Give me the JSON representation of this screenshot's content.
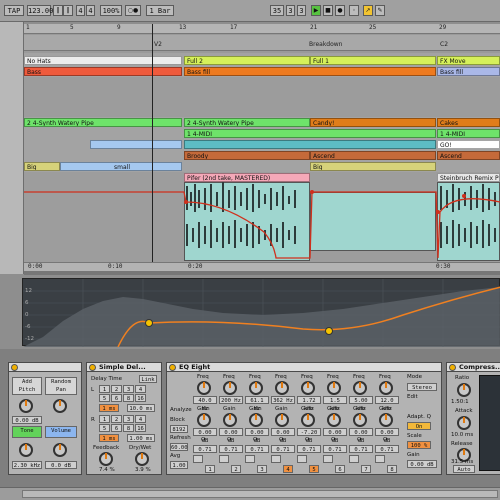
{
  "transport": {
    "tap": "TAP",
    "tempo": "123.00",
    "signature_num": "4",
    "signature_den": "4",
    "zoom": "100%",
    "quantize": "1 Bar",
    "position_bar": "35",
    "position_beat": "3",
    "position_sixteenth": "3"
  },
  "ruler": {
    "bars": [
      "1",
      "5",
      "9",
      "13",
      "17",
      "21",
      "25",
      "29"
    ]
  },
  "locators": [
    "V2",
    "Breakdown",
    "C2"
  ],
  "clips": {
    "no_hats": "No Hats",
    "full2": "Full 2",
    "full1": "Full 1",
    "fx_move": "FX Move",
    "bass": "Bass",
    "bass_fill": "Bass fill",
    "bass_fill2": "Bass fill",
    "synth_a": "2 4-Synth Watery Pipe",
    "synth_b": "2 4-Synth Watery Pipe",
    "candy": "Candy!",
    "cakes": "Cakes",
    "midi_a": "1 4-MIDI",
    "midi_b": "1 4-MIDI",
    "gol": "GO!",
    "broody": "Broody",
    "ascend": "Ascend",
    "ascend2": "Ascend",
    "big": "Big",
    "small": "small",
    "big2": "Big",
    "audio_main": "Pifer (2nd take, MASTERED)",
    "audio_right": "Steinbruch Remix PREM"
  },
  "time_ruler": [
    "0:00",
    "0:10",
    "0:20",
    "0:30"
  ],
  "eq_display": {
    "grid_labels": [
      "12",
      "6",
      "0",
      "-6",
      "-12"
    ]
  },
  "devices": {
    "pitch": {
      "title": "",
      "add_pitch": "Add Pitch",
      "random_pan": "Random Pan",
      "val1": "0.00 dB",
      "tone": "Tone",
      "volume": "Volume",
      "val2": "2.30 kHz",
      "val3": "0.0 dB"
    },
    "delay": {
      "title": "Simple Del...",
      "delay_time": "Delay Time",
      "link": "Link",
      "left": "L",
      "right": "R",
      "sync": [
        "1",
        "2",
        "3",
        "4",
        "5",
        "6",
        "8",
        "16"
      ],
      "time_l": "1 ms",
      "time_l2": "10.0 ms",
      "time_r": "1 ms",
      "time_r2": "1.00 ms",
      "feedback": "Feedback",
      "drywet": "Dry/Wet",
      "feedback_val": "7.4 %",
      "drywet_val": "3.9 %"
    },
    "eq8": {
      "title": "EQ Eight",
      "analyze": "Analyze",
      "block": "Block",
      "block_val": "8192",
      "refresh": "Refresh",
      "refresh_val": "60.00",
      "avg": "Avg",
      "avg_val": "1.00",
      "bands": [
        {
          "freq": "40.0 Hz",
          "gain": "0.00 dB",
          "q": "0.71"
        },
        {
          "freq": "200 Hz",
          "gain": "0.00 dB",
          "q": "0.71"
        },
        {
          "freq": "61.1 Hz",
          "gain": "0.00 dB",
          "q": "0.71"
        },
        {
          "freq": "362 Hz",
          "gain": "0.00 dB",
          "q": "0.71"
        },
        {
          "freq": "1.72 kHz",
          "gain": "-7.20 dB",
          "q": "0.71"
        },
        {
          "freq": "1.5 kHz",
          "gain": "0.00 dB",
          "q": "0.71"
        },
        {
          "freq": "5.00 kHz",
          "gain": "0.00 dB",
          "q": "0.71"
        },
        {
          "freq": "12.0 kHz",
          "gain": "0.00 dB",
          "q": "0.71"
        }
      ],
      "freq_label": "Freq",
      "gain_label": "Gain",
      "q_label": "Q",
      "mode": "Mode",
      "mode_val": "Stereo",
      "edit": "Edit",
      "adapt": "Adapt. Q",
      "adapt_val": "On",
      "scale": "Scale",
      "scale_val": "100 %",
      "gain": "Gain",
      "gain_val": "0.00 dB",
      "band_numbers": [
        "1",
        "2",
        "3",
        "4",
        "5",
        "6",
        "7",
        "8"
      ]
    },
    "comp": {
      "title": "Compress...",
      "ratio": "Ratio",
      "ratio_val": "1.50:1",
      "attack": "Attack",
      "attack_val": "10.0 ms",
      "release": "Release",
      "release_val": "31.5 ms",
      "auto": "Auto"
    }
  }
}
